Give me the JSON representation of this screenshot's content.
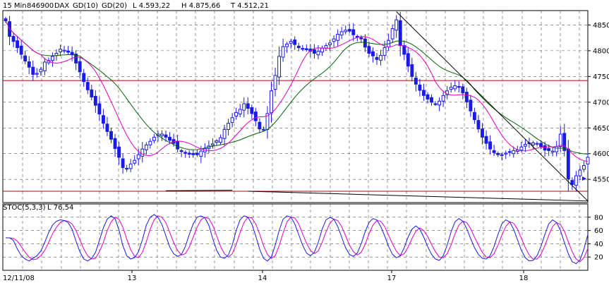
{
  "header": {
    "timeframe": "15 Min",
    "symbol_id": "846900",
    "symbol": "DAX",
    "ma10_label": "GD(10)",
    "ma20_label": "GD(20)",
    "low_label": "L 4.593,22",
    "high_label": "H 4.875,66",
    "close_label": "T 4.512,21"
  },
  "stoch_header": {
    "name": "STOC(5,3,3)",
    "value_label": "L 76,54"
  },
  "colors": {
    "background": "#ffffff",
    "plot_bg": "#ffffff",
    "grid": "#555555",
    "candle": "#1a1ae6",
    "ma10": "#e000c0",
    "ma20": "#006400",
    "support": "#c00000",
    "trendline": "#000000",
    "stoch_k": "#1a1ae6",
    "stoch_d": "#e000c0",
    "ma10_text": "#d000b0",
    "ma20_text": "#006400"
  },
  "chart_data": [
    {
      "type": "candlestick",
      "price_ticks": [
        "4850",
        "4800",
        "4750",
        "4700",
        "4650",
        "4600",
        "4550"
      ],
      "ylim": [
        4505,
        4878
      ],
      "date_labels": [
        "12/11/08",
        "13",
        "14",
        "17",
        "18"
      ],
      "horizontal_lines": [
        4742,
        4527
      ],
      "x": [
        0,
        1,
        2,
        3,
        4,
        5,
        6,
        7,
        8,
        9,
        10,
        11,
        12,
        13,
        14,
        15,
        16,
        17,
        18,
        19,
        20,
        21,
        22,
        23,
        24,
        25,
        26,
        27,
        28,
        29,
        30,
        31,
        32,
        33,
        34,
        35,
        36,
        37,
        38,
        39,
        40,
        41,
        42,
        43,
        44,
        45,
        46,
        47,
        48,
        49,
        50,
        51,
        52,
        53,
        54,
        55,
        56,
        57,
        58,
        59,
        60,
        61,
        62,
        63,
        64,
        65,
        66,
        67,
        68,
        69,
        70,
        71,
        72,
        73,
        74,
        75,
        76,
        77,
        78,
        79,
        80,
        81,
        82,
        83,
        84,
        85,
        86,
        87,
        88,
        89,
        90,
        91,
        92,
        93,
        94,
        95,
        96,
        97,
        98,
        99,
        100,
        101,
        102,
        103,
        104,
        105,
        106,
        107,
        108,
        109,
        110,
        111,
        112,
        113,
        114,
        115,
        116,
        117,
        118,
        119,
        120,
        121,
        122,
        123,
        124,
        125,
        126,
        127,
        128,
        129,
        130,
        131,
        132,
        133,
        134,
        135,
        136,
        137,
        138,
        139,
        140,
        141,
        142,
        143,
        144,
        145,
        146,
        147,
        148,
        149,
        150,
        151,
        152,
        153,
        154,
        155,
        156,
        157,
        158,
        159,
        160,
        161,
        162,
        163,
        164,
        165,
        166,
        167,
        168,
        169,
        170,
        171,
        172,
        173,
        174,
        175,
        176,
        177,
        178,
        179,
        180,
        181,
        182,
        183,
        184
      ],
      "close": [
        4858,
        4828,
        4818,
        4806,
        4793,
        4780,
        4768,
        4754,
        4756,
        4764,
        4778,
        4781,
        4789,
        4795,
        4803,
        4801,
        4797,
        4792,
        4776,
        4759,
        4740,
        4724,
        4710,
        4694,
        4677,
        4659,
        4643,
        4628,
        4610,
        4593,
        4573,
        4571,
        4580,
        4587,
        4598,
        4609,
        4617,
        4624,
        4632,
        4638,
        4638,
        4632,
        4626,
        4620,
        4609,
        4604,
        4601,
        4599,
        4598,
        4598,
        4605,
        4610,
        4615,
        4619,
        4625,
        4631,
        4647,
        4659,
        4670,
        4680,
        4686,
        4697,
        4688,
        4678,
        4664,
        4648,
        4647,
        4678,
        4722,
        4752,
        4789,
        4808,
        4813,
        4818,
        4812,
        4806,
        4804,
        4802,
        4799,
        4795,
        4799,
        4805,
        4810,
        4815,
        4823,
        4832,
        4837,
        4840,
        4838,
        4831,
        4827,
        4823,
        4807,
        4795,
        4790,
        4783,
        4791,
        4806,
        4820,
        4843,
        4860,
        4810,
        4793,
        4770,
        4750,
        4735,
        4723,
        4713,
        4706,
        4700,
        4696,
        4702,
        4713,
        4722,
        4729,
        4732,
        4730,
        4718,
        4701,
        4683,
        4666,
        4648,
        4632,
        4620,
        4609,
        4602,
        4598,
        4598,
        4601,
        4603,
        4606,
        4607,
        4613,
        4618,
        4620,
        4621,
        4620,
        4614,
        4607,
        4606,
        4605,
        4614,
        4638,
        4606,
        4551,
        4540,
        4557,
        4568,
        4577,
        4593
      ]
    },
    {
      "type": "line",
      "series": [
        {
          "name": "K",
          "values": [
            49,
            49,
            45,
            32,
            22,
            17,
            14,
            18,
            22,
            29,
            42,
            57,
            68,
            74,
            76,
            75,
            72,
            62,
            44,
            28,
            17,
            14,
            18,
            27,
            45,
            64,
            77,
            82,
            78,
            61,
            37,
            22,
            17,
            19,
            28,
            46,
            68,
            80,
            84,
            80,
            69,
            52,
            35,
            25,
            21,
            24,
            36,
            54,
            70,
            80,
            82,
            79,
            68,
            48,
            30,
            20,
            18,
            23,
            38,
            60,
            76,
            82,
            80,
            70,
            52,
            32,
            18,
            14,
            20,
            38,
            60,
            77,
            82,
            80,
            70,
            54,
            38,
            26,
            22,
            27,
            42,
            62,
            76,
            80,
            77,
            66,
            50,
            34,
            24,
            21,
            26,
            40,
            58,
            72,
            78,
            76,
            66,
            52,
            36,
            24,
            19,
            22,
            34,
            50,
            62,
            67,
            62,
            50,
            36,
            24,
            17,
            15,
            22,
            38,
            58,
            73,
            78,
            74,
            63,
            48,
            34,
            24,
            18,
            17,
            22,
            36,
            54,
            70,
            76,
            73,
            62,
            46,
            30,
            19,
            14,
            15,
            22,
            36,
            54,
            70,
            76,
            72,
            60,
            42,
            25,
            13,
            10,
            16,
            32,
            54
          ]
        },
        {
          "name": "D",
          "values": [
            49,
            49,
            48,
            44,
            36,
            27,
            20,
            16,
            17,
            22,
            30,
            42,
            55,
            65,
            72,
            75,
            74,
            70,
            60,
            46,
            32,
            22,
            17,
            18,
            28,
            42,
            60,
            73,
            80,
            77,
            65,
            47,
            31,
            21,
            19,
            27,
            43,
            62,
            76,
            82,
            80,
            72,
            57,
            42,
            30,
            23,
            25,
            35,
            50,
            65,
            76,
            80,
            78,
            68,
            52,
            36,
            25,
            20,
            25,
            39,
            57,
            72,
            80,
            79,
            70,
            55,
            37,
            24,
            18,
            22,
            37,
            56,
            73,
            80,
            79,
            70,
            55,
            41,
            30,
            25,
            29,
            42,
            58,
            71,
            77,
            75,
            66,
            52,
            38,
            28,
            23,
            27,
            39,
            55,
            68,
            75,
            74,
            66,
            53,
            40,
            29,
            22,
            25,
            35,
            48,
            59,
            64,
            60,
            51,
            39,
            28,
            20,
            19,
            25,
            38,
            55,
            68,
            74,
            72,
            63,
            50,
            38,
            27,
            20,
            19,
            25,
            38,
            53,
            66,
            73,
            71,
            62,
            48,
            34,
            23,
            17,
            17,
            24,
            37,
            53,
            66,
            72,
            69,
            59,
            43,
            28,
            17,
            13,
            19,
            33
          ]
        }
      ],
      "y_ticks": [
        "80",
        "60",
        "40",
        "20"
      ],
      "ylim": [
        0,
        100
      ]
    }
  ]
}
